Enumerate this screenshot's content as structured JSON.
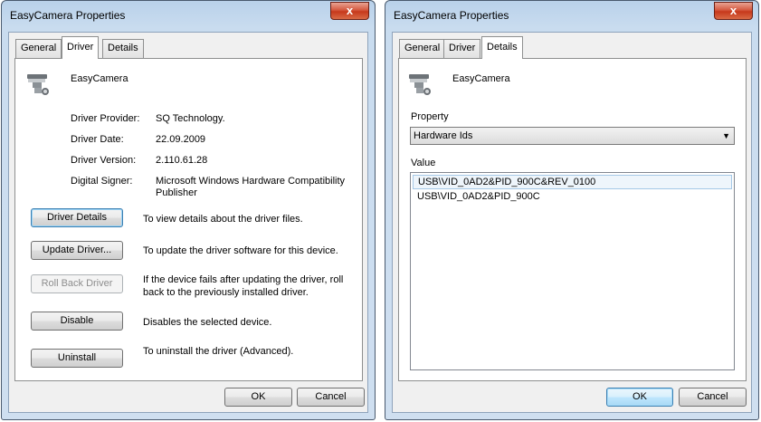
{
  "left": {
    "title": "EasyCamera Properties",
    "close": "x",
    "tabs": [
      "General",
      "Driver",
      "Details"
    ],
    "device_name": "EasyCamera",
    "info": [
      {
        "label": "Driver Provider:",
        "value": "SQ Technology."
      },
      {
        "label": "Driver Date:",
        "value": "22.09.2009"
      },
      {
        "label": "Driver Version:",
        "value": "2.110.61.28"
      },
      {
        "label": "Digital Signer:",
        "value": "Microsoft Windows Hardware Compatibility Publisher"
      }
    ],
    "actions": [
      {
        "button": "Driver Details",
        "description": "To view details about the driver files."
      },
      {
        "button": "Update Driver...",
        "description": "To update the driver software for this device."
      },
      {
        "button": "Roll Back Driver",
        "description": "If the device fails after updating the driver, roll back to the previously installed driver."
      },
      {
        "button": "Disable",
        "description": "Disables the selected device."
      },
      {
        "button": "Uninstall",
        "description": "To uninstall the driver (Advanced)."
      }
    ],
    "ok": "OK",
    "cancel": "Cancel"
  },
  "right": {
    "title": "EasyCamera Properties",
    "close": "x",
    "tabs": [
      "General",
      "Driver",
      "Details"
    ],
    "device_name": "EasyCamera",
    "property_label": "Property",
    "property_value": "Hardware Ids",
    "value_label": "Value",
    "values": [
      "USB\\VID_0AD2&PID_900C&REV_0100",
      "USB\\VID_0AD2&PID_900C"
    ],
    "ok": "OK",
    "cancel": "Cancel"
  }
}
